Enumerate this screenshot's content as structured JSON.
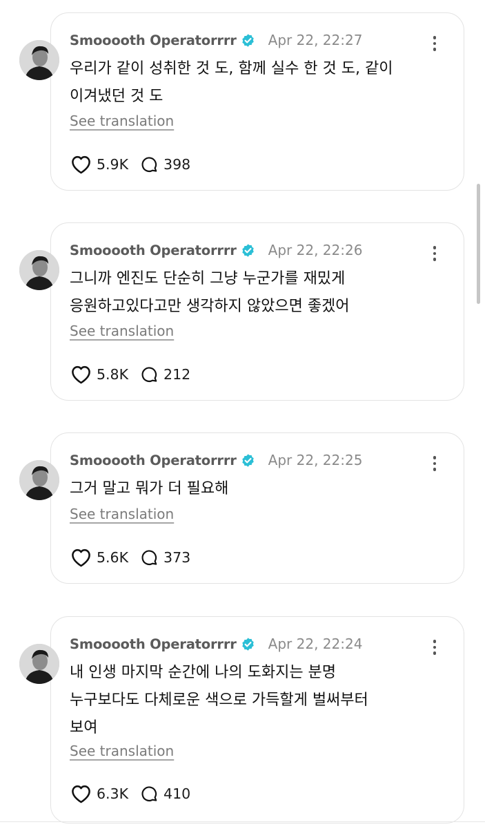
{
  "posts": [
    {
      "username": "Smooooth Operatorrrr",
      "timestamp": "Apr 22, 22:27",
      "lines": [
        "우리가 같이 성취한 것 도, 함께 실수 한 것 도, 같이",
        "이겨냈던 것 도"
      ],
      "translate": "See translation",
      "likes": "5.9K",
      "replies": "398"
    },
    {
      "username": "Smooooth Operatorrrr",
      "timestamp": "Apr 22, 22:26",
      "lines": [
        "그니까 엔진도 단순히 그냥 누군가를 재밌게",
        "응원하고있다고만 생각하지 않았으면 좋겠어"
      ],
      "translate": "See translation",
      "likes": "5.8K",
      "replies": "212"
    },
    {
      "username": "Smooooth Operatorrrr",
      "timestamp": "Apr 22, 22:25",
      "lines": [
        "그거 말고 뭐가 더 필요해"
      ],
      "translate": "See translation",
      "likes": "5.6K",
      "replies": "373"
    },
    {
      "username": "Smooooth Operatorrrr",
      "timestamp": "Apr 22, 22:24",
      "lines": [
        "내 인생 마지막 순간에 나의 도화지는 분명",
        "누구보다도 다체로운 색으로 가득할게 벌써부터",
        "보여"
      ],
      "translate": "See translation",
      "likes": "6.3K",
      "replies": "410"
    }
  ],
  "colors": {
    "verified_badge": "#2bbfd6",
    "card_border": "#e3e3e3",
    "username": "#5b5b5b",
    "timestamp": "#8a8a8a"
  },
  "icons": {
    "verified": "verified-badge-icon",
    "more": "more-options-icon",
    "like": "heart-icon",
    "reply": "comment-bubble-icon"
  }
}
